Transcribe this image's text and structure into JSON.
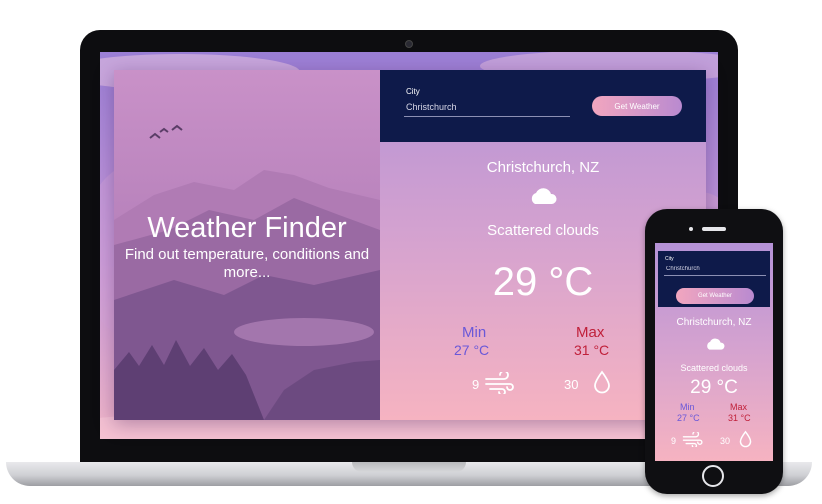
{
  "app": {
    "hero_title": "Weather Finder",
    "hero_subtitle": "Find out temperature, conditions and more..."
  },
  "search": {
    "label": "City",
    "value": "Christchurch",
    "button_label": "Get Weather"
  },
  "weather": {
    "location": "Christchurch, NZ",
    "icon": "cloud-icon",
    "condition": "Scattered clouds",
    "temperature": "29 °C",
    "min_label": "Min",
    "min_value": "27 °C",
    "max_label": "Max",
    "max_value": "31 °C",
    "wind_value": "9",
    "wind_icon": "wind-icon",
    "humidity_value": "30",
    "humidity_icon": "water-drop-icon"
  },
  "colors": {
    "search_bar": "#0e1a4a",
    "min_text": "#6a58d8",
    "max_text": "#c0203a",
    "button_gradient_start": "#f2a6bf",
    "button_gradient_end": "#b98ad0"
  }
}
